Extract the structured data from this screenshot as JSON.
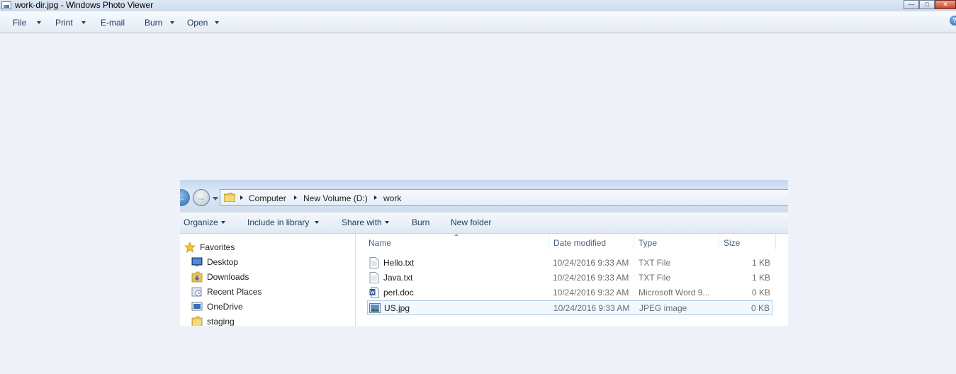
{
  "window": {
    "title": "work-dir.jpg - Windows Photo Viewer",
    "minimize_icon": "minimize-icon",
    "maximize_icon": "maximize-icon",
    "close_icon": "close-icon"
  },
  "menu": {
    "items": [
      "File",
      "Print",
      "E-mail",
      "Burn",
      "Open"
    ],
    "help_icon": "help-icon",
    "help_glyph": "?"
  },
  "explorer": {
    "breadcrumb": [
      "Computer",
      "New Volume (D:)",
      "work"
    ],
    "toolbar": [
      "Organize",
      "Include in library",
      "Share with",
      "Burn",
      "New folder"
    ],
    "nav": {
      "favorites": "Favorites",
      "items": [
        "Desktop",
        "Downloads",
        "Recent Places",
        "OneDrive",
        "staging"
      ]
    },
    "columns": [
      "Name",
      "Date modified",
      "Type",
      "Size"
    ],
    "files": [
      {
        "name": "Hello.txt",
        "date": "10/24/2016 9:33 AM",
        "type": "TXT File",
        "size": "1 KB",
        "icon": "text-file-icon"
      },
      {
        "name": "Java.txt",
        "date": "10/24/2016 9:33 AM",
        "type": "TXT File",
        "size": "1 KB",
        "icon": "text-file-icon"
      },
      {
        "name": "perl.doc",
        "date": "10/24/2016 9:32 AM",
        "type": "Microsoft Word 9...",
        "size": "0 KB",
        "icon": "word-document-icon"
      },
      {
        "name": "US.jpg",
        "date": "10/24/2016 9:33 AM",
        "type": "JPEG image",
        "size": "0 KB",
        "icon": "jpeg-image-icon",
        "selected": true
      }
    ]
  },
  "colors": {
    "background": "#eef1f8",
    "menu_text": "#1e395b",
    "selection_border": "#a9cbe8"
  }
}
